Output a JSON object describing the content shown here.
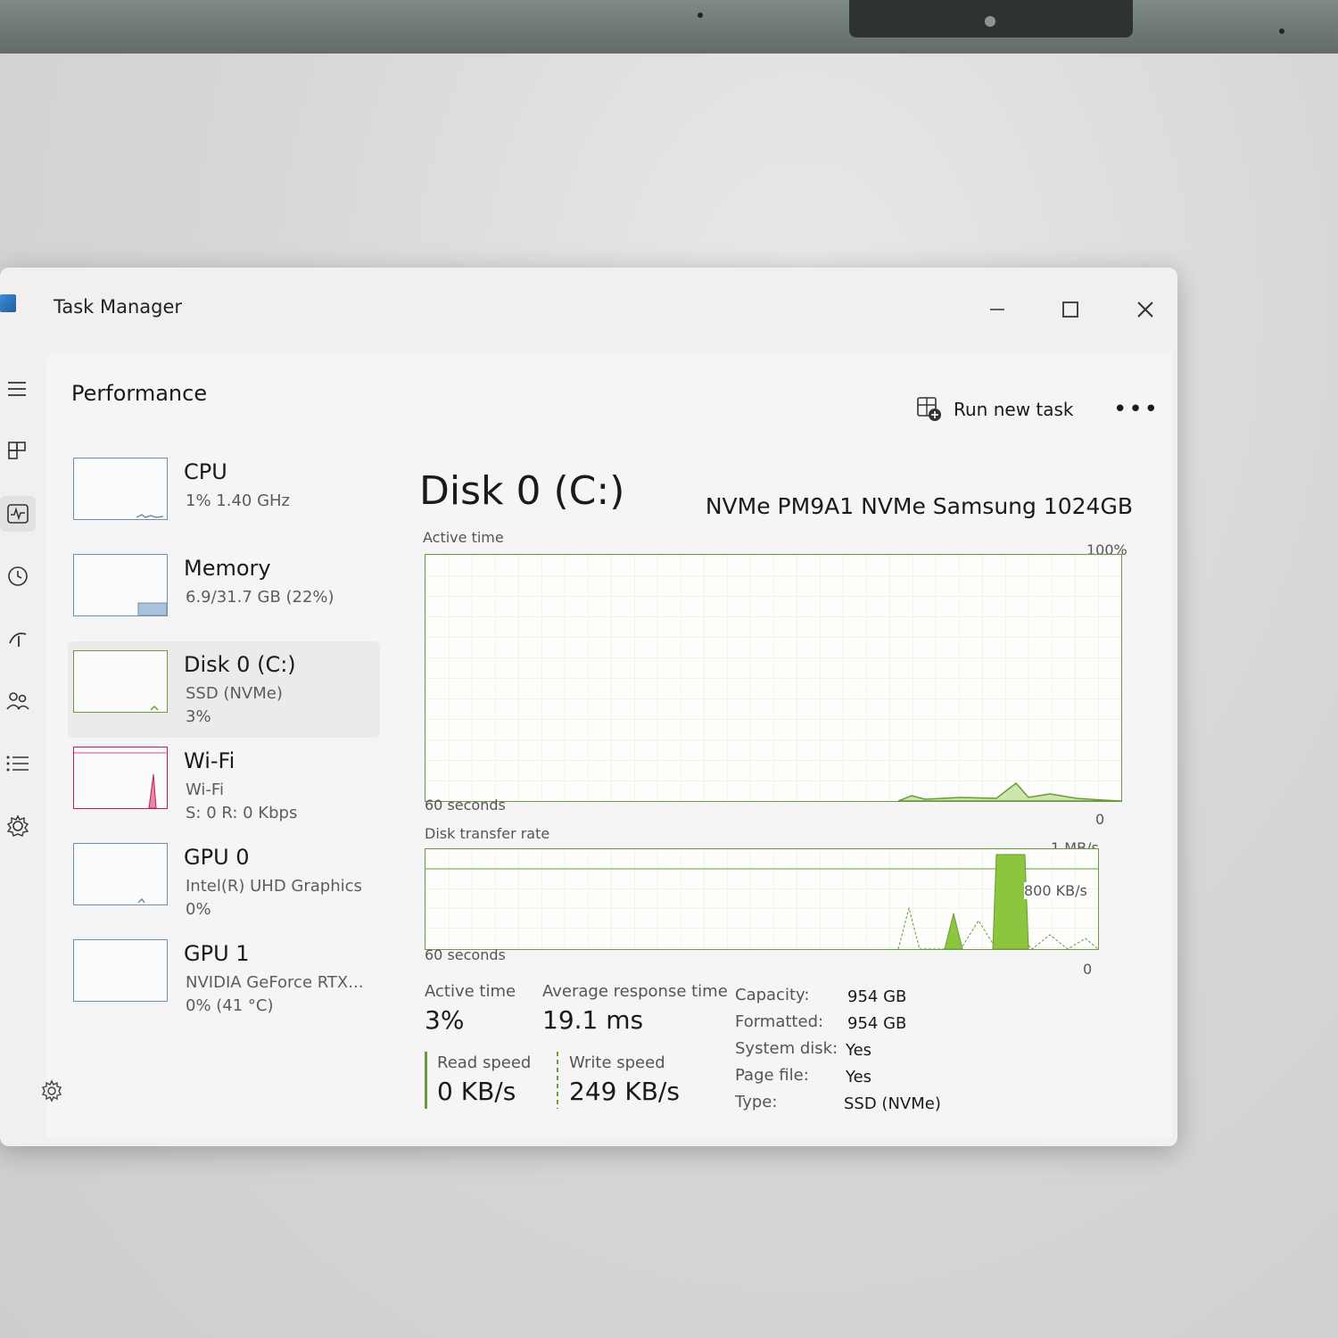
{
  "window": {
    "title": "Task Manager",
    "minimize_icon": "minimize-icon",
    "maximize_icon": "maximize-icon",
    "close_icon": "close-icon"
  },
  "nav": {
    "items": [
      "hamburger-menu-icon",
      "processes-icon",
      "performance-icon",
      "app-history-icon",
      "startup-apps-icon",
      "users-icon",
      "details-icon",
      "services-icon"
    ],
    "settings_icon": "settings-icon"
  },
  "header": {
    "title": "Performance",
    "run_new_task": "Run new task",
    "more": "•••"
  },
  "sidebar": {
    "items": [
      {
        "name": "CPU",
        "line1": "1%  1.40 GHz",
        "line2": "",
        "usage": 0.01
      },
      {
        "name": "Memory",
        "line1": "6.9/31.7 GB (22%)",
        "line2": "",
        "usage": 0.22
      },
      {
        "name": "Disk 0 (C:)",
        "line1": "SSD (NVMe)",
        "line2": "3%",
        "usage": 0.03
      },
      {
        "name": "Wi-Fi",
        "line1": "Wi-Fi",
        "line2": "S: 0  R: 0 Kbps",
        "usage": 0.0
      },
      {
        "name": "GPU 0",
        "line1": "Intel(R) UHD Graphics",
        "line2": "0%",
        "usage": 0.0
      },
      {
        "name": "GPU 1",
        "line1": "NVIDIA GeForce RTX...",
        "line2": "0%  (41 °C)",
        "usage": 0.0
      }
    ]
  },
  "detail": {
    "title": "Disk 0 (C:)",
    "model": "NVMe PM9A1 NVMe Samsung 1024GB",
    "active_chart": {
      "label": "Active time",
      "max_label": "100%",
      "min_label": "0",
      "time_label": "60 seconds"
    },
    "transfer_chart": {
      "label": "Disk transfer rate",
      "max_label": "1 MB/s",
      "mid_label": "800 KB/s",
      "min_label": "0",
      "time_label": "60 seconds"
    },
    "stats": {
      "active_time_label": "Active time",
      "active_time_value": "3%",
      "avg_response_label": "Average response time",
      "avg_response_value": "19.1 ms",
      "read_speed_label": "Read speed",
      "read_speed_value": "0 KB/s",
      "write_speed_label": "Write speed",
      "write_speed_value": "249 KB/s"
    },
    "properties": [
      {
        "label": "Capacity:",
        "value": "954 GB"
      },
      {
        "label": "Formatted:",
        "value": "954 GB"
      },
      {
        "label": "System disk:",
        "value": "Yes"
      },
      {
        "label": "Page file:",
        "value": "Yes"
      },
      {
        "label": "Type:",
        "value": "SSD (NVMe)"
      }
    ]
  },
  "colors": {
    "disk_accent": "#6a9a3a",
    "disk_fill": "#8cc63f",
    "cpu_accent": "#6f8fae",
    "wifi_accent": "#c2185b"
  }
}
